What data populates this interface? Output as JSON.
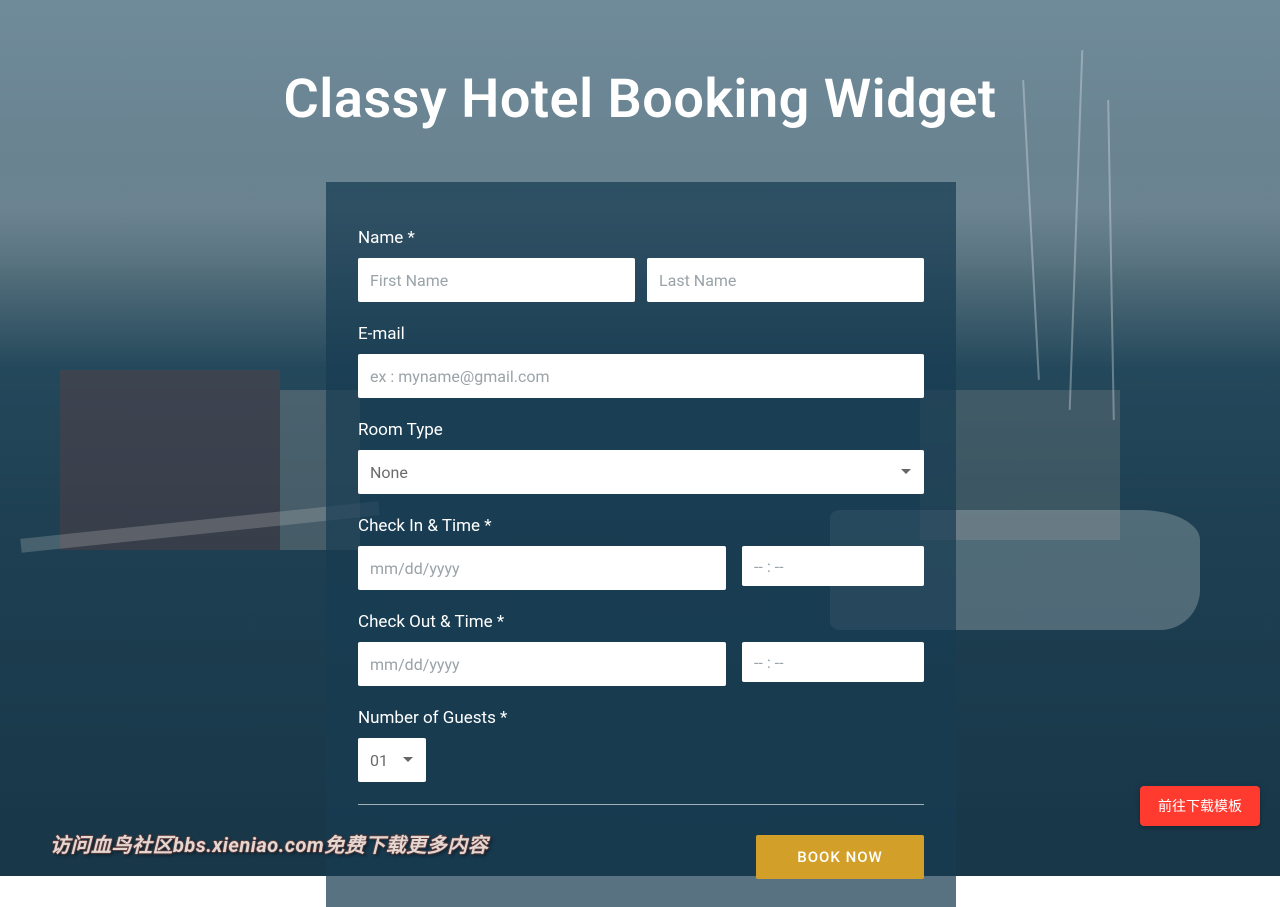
{
  "page": {
    "title": "Classy Hotel Booking Widget"
  },
  "form": {
    "name": {
      "label": "Name *",
      "first_placeholder": "First Name",
      "last_placeholder": "Last Name",
      "first_value": "",
      "last_value": ""
    },
    "email": {
      "label": "E-mail",
      "placeholder": "ex : myname@gmail.com",
      "value": ""
    },
    "room_type": {
      "label": "Room Type",
      "selected": "None"
    },
    "check_in": {
      "label": "Check In & Time *",
      "date_placeholder": "mm/dd/yyyy",
      "date_value": "",
      "time_placeholder": "-- : --",
      "time_value": ""
    },
    "check_out": {
      "label": "Check Out & Time *",
      "date_placeholder": "mm/dd/yyyy",
      "date_value": "",
      "time_placeholder": "-- : --",
      "time_value": ""
    },
    "guests": {
      "label": "Number of Guests *",
      "selected": "01"
    },
    "submit_label": "BOOK NOW"
  },
  "float_button": {
    "label": "前往下载模板"
  },
  "watermark": {
    "text": "访问血鸟社区bbs.xieniao.com免费下载更多内容"
  },
  "colors": {
    "accent": "#D2A029",
    "float_btn": "#ff3b30",
    "card_bg": "rgba(24,60,82,0.72)"
  }
}
